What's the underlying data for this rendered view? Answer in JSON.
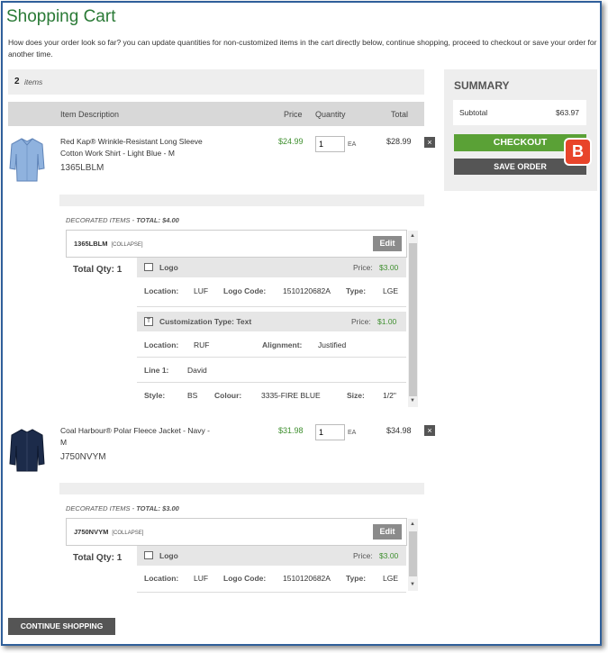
{
  "page": {
    "title": "Shopping Cart",
    "intro": "How does your order look so far? you can update quantities for non-customized items in the cart directly below, continue shopping, proceed to checkout or save your order for another time."
  },
  "cart": {
    "count": "2",
    "count_label": "items",
    "headers": {
      "description": "Item Description",
      "price": "Price",
      "quantity": "Quantity",
      "total": "Total"
    }
  },
  "items": [
    {
      "name": "Red Kap® Wrinkle-Resistant Long Sleeve Cotton Work Shirt - Light Blue - M",
      "sku": "1365LBLM",
      "price": "$24.99",
      "qty": "1",
      "unit": "EA",
      "total": "$28.99",
      "remove": "×",
      "decorated_label": "DECORATED ITEMS - ",
      "decorated_total": "TOTAL: $4.00",
      "deco_code": "1365LBLM",
      "collapse": "[COLLAPSE]",
      "edit": "Edit",
      "total_qty": "Total Qty: 1",
      "logo": {
        "title": "Logo",
        "price_label": "Price:",
        "price": "$3.00",
        "location_label": "Location:",
        "location": "LUF",
        "code_label": "Logo Code:",
        "code": "1510120682A",
        "type_label": "Type:",
        "type": "LGE"
      },
      "text": {
        "title": "Customization Type: Text",
        "price_label": "Price:",
        "price": "$1.00",
        "location_label": "Location:",
        "location": "RUF",
        "alignment_label": "Alignment:",
        "alignment": "Justified",
        "line1_label": "Line 1:",
        "line1": "David",
        "style_label": "Style:",
        "style": "BS",
        "colour_label": "Colour:",
        "colour": "3335-FIRE BLUE",
        "size_label": "Size:",
        "size": "1/2\""
      }
    },
    {
      "name": "Coal Harbour® Polar Fleece Jacket - Navy - M",
      "sku": "J750NVYM",
      "price": "$31.98",
      "qty": "1",
      "unit": "EA",
      "total": "$34.98",
      "remove": "×",
      "decorated_label": "DECORATED ITEMS - ",
      "decorated_total": "TOTAL: $3.00",
      "deco_code": "J750NVYM",
      "collapse": "[COLLAPSE]",
      "edit": "Edit",
      "total_qty": "Total Qty: 1",
      "logo": {
        "title": "Logo",
        "price_label": "Price:",
        "price": "$3.00",
        "location_label": "Location:",
        "location": "LUF",
        "code_label": "Logo Code:",
        "code": "1510120682A",
        "type_label": "Type:",
        "type": "LGE"
      }
    }
  ],
  "summary": {
    "title": "SUMMARY",
    "subtotal_label": "Subtotal",
    "subtotal": "$63.97",
    "checkout": "CHECKOUT",
    "save": "SAVE ORDER",
    "badge": "B"
  },
  "footer": {
    "continue": "CONTINUE SHOPPING"
  },
  "colors": {
    "accent_green": "#5aa136",
    "title_green": "#2a7a36",
    "price_green": "#3f8f2f",
    "badge_red": "#e8442a",
    "border_blue": "#2f5f9a"
  }
}
